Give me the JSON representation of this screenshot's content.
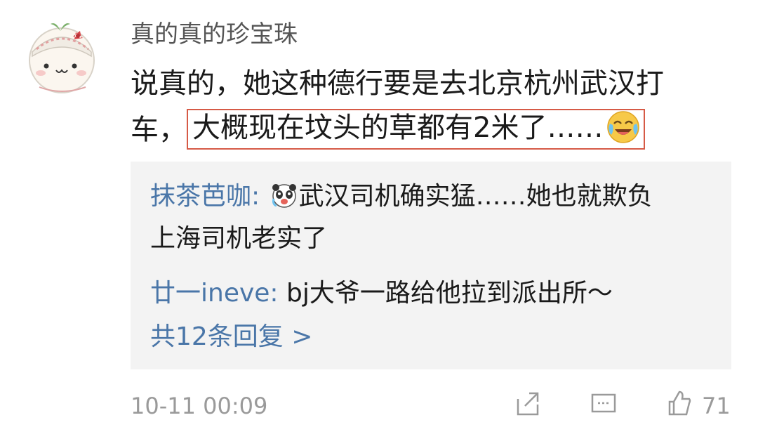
{
  "post": {
    "username": "真的真的珍宝珠",
    "comment_line1": "说真的，她这种德行要是去北京杭州武汉打",
    "comment_line2_prefix": "车，",
    "comment_highlight": "大概现在坟头的草都有2米了……",
    "highlight_color": "#d65a46",
    "emoji": "laugh-cry-emoji"
  },
  "replies": [
    {
      "name": "抹茶芭咖",
      "colon": ":",
      "emoji": "panda-emoji",
      "text_line1": "武汉司机确实猛……她也就欺负",
      "text_line2": "上海司机老实了"
    },
    {
      "name": "廿一ineve",
      "colon": ":",
      "text_line1": "bj大爷一路给他拉到派出所～"
    }
  ],
  "more_replies": "共12条回复 >",
  "footer": {
    "timestamp": "10-11 00:09",
    "like_count": "71",
    "icons": [
      "share-icon",
      "comment-icon",
      "like-icon"
    ]
  },
  "colors": {
    "link": "#4a76a8",
    "reply_bg": "#f3f3f3",
    "meta": "#9a9a9a"
  }
}
